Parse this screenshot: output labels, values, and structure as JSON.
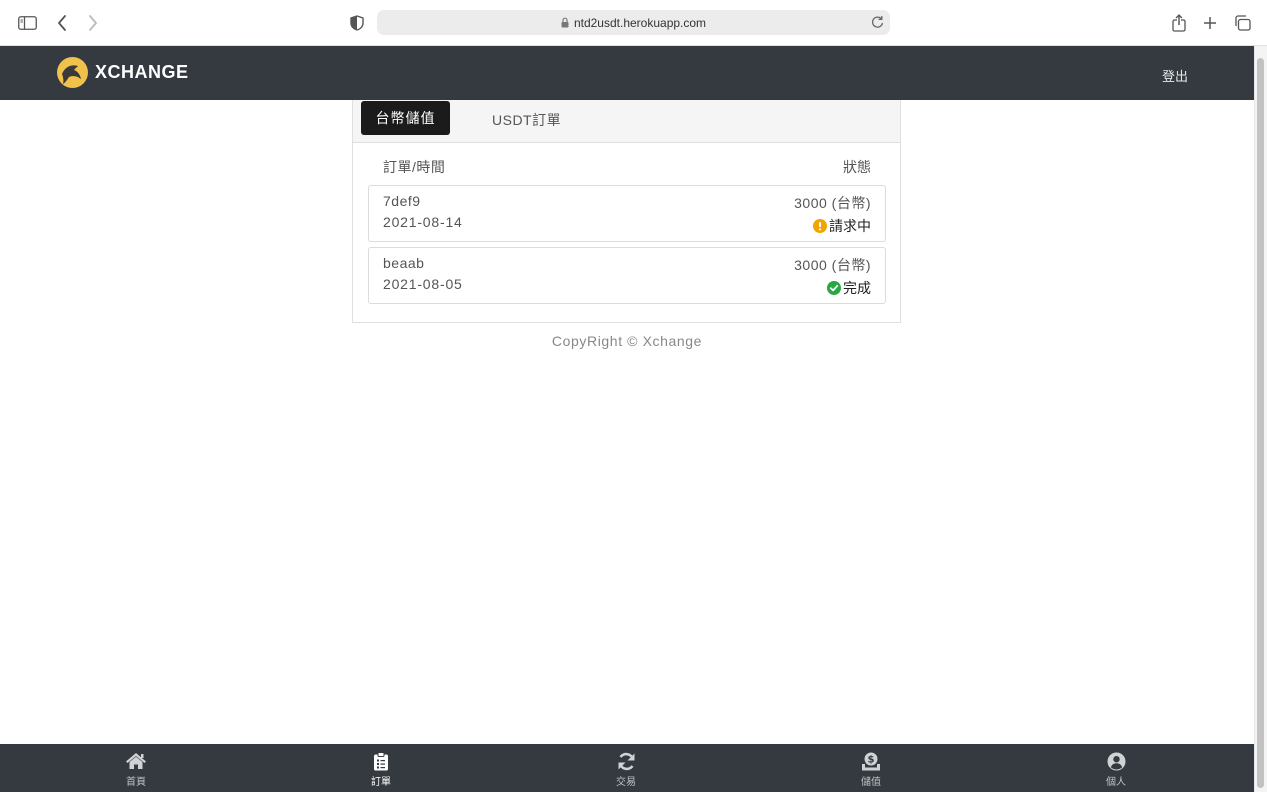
{
  "browser": {
    "url": "ntd2usdt.herokuapp.com",
    "icons": [
      "sidebar-icon",
      "back-icon",
      "forward-icon",
      "shield-icon",
      "lock-icon",
      "reload-icon",
      "share-icon",
      "new-tab-icon",
      "tabs-overview-icon"
    ]
  },
  "header": {
    "brand": "XCHANGE",
    "logout_label": "登出",
    "logo_color": "#f0c14b"
  },
  "tabs": [
    {
      "label": "台幣儲值",
      "active": true
    },
    {
      "label": "USDT訂單",
      "active": false
    }
  ],
  "table": {
    "col_left": "訂單/時間",
    "col_right": "狀態",
    "orders": [
      {
        "id": "7def9",
        "date": "2021-08-14",
        "amount": "3000 (台幣)",
        "status": "請求中",
        "status_icon": "exclamation-circle-icon",
        "status_color": "#f0a500"
      },
      {
        "id": "beaab",
        "date": "2021-08-05",
        "amount": "3000 (台幣)",
        "status": "完成",
        "status_icon": "check-circle-icon",
        "status_color": "#28a745"
      }
    ]
  },
  "footer": {
    "copyright": "CopyRight © Xchange"
  },
  "bottom_nav": [
    {
      "label": "首頁",
      "icon": "home-icon",
      "active": false
    },
    {
      "label": "訂單",
      "icon": "clipboard-icon",
      "active": true
    },
    {
      "label": "交易",
      "icon": "sync-icon",
      "active": false
    },
    {
      "label": "儲值",
      "icon": "deposit-icon",
      "active": false
    },
    {
      "label": "個人",
      "icon": "user-circle-icon",
      "active": false
    }
  ]
}
